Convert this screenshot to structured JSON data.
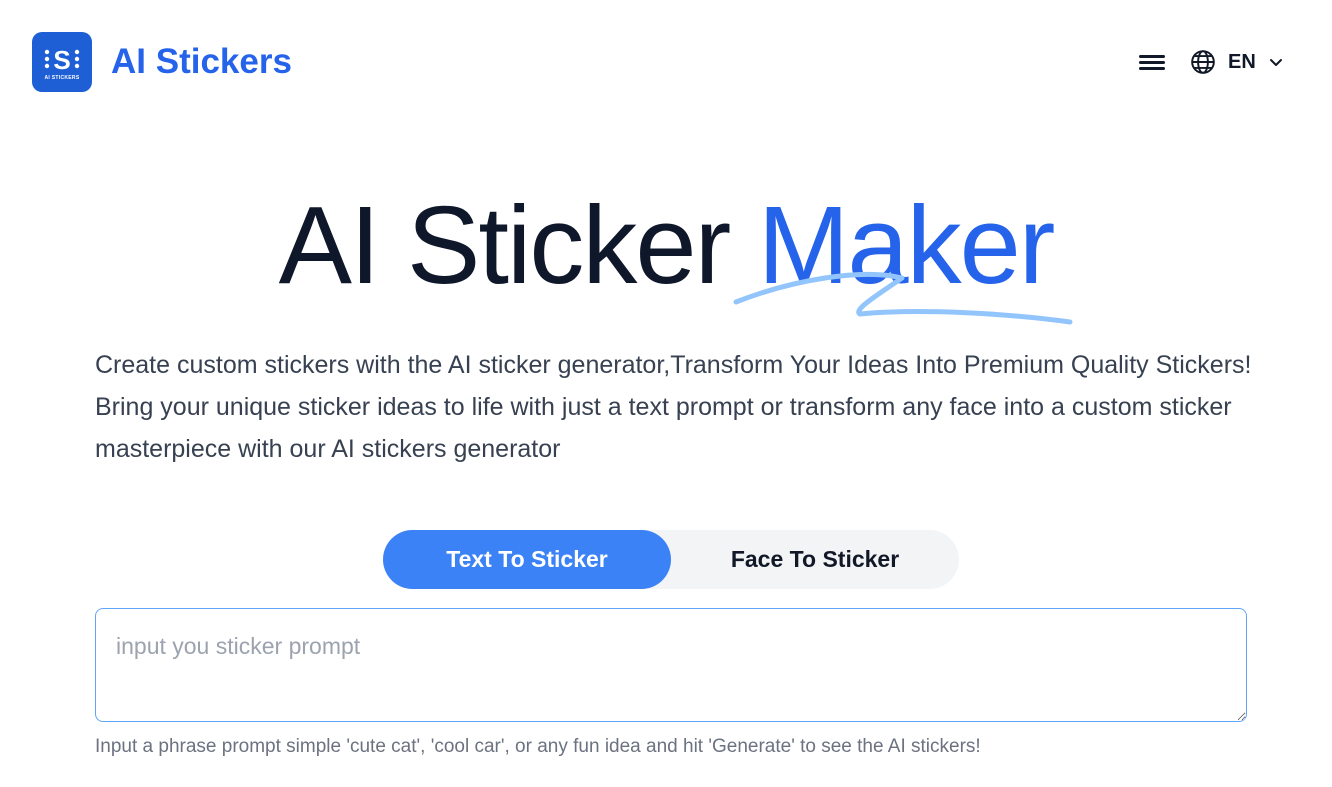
{
  "brand": {
    "name": "AI Stickers",
    "logo_caption": "AI STICKERS",
    "color": "#2563eb"
  },
  "header": {
    "menu_icon": "hamburger-icon",
    "language": {
      "icon": "globe-icon",
      "code": "EN",
      "chevron": "chevron-down-icon"
    }
  },
  "hero": {
    "title_main": "AI Sticker",
    "title_accent": "Maker",
    "accent_color": "#2563eb",
    "description": "Create custom stickers with the AI sticker generator,Transform Your Ideas Into Premium Quality Stickers! Bring your unique sticker ideas to life with just a text prompt or transform any face into a custom sticker masterpiece with our AI stickers generator"
  },
  "tabs": [
    {
      "label": "Text To Sticker",
      "active": true
    },
    {
      "label": "Face To Sticker",
      "active": false
    }
  ],
  "prompt": {
    "value": "",
    "placeholder": "input you sticker prompt",
    "hint": "Input a phrase prompt simple 'cute cat', 'cool car', or any fun idea and hit 'Generate' to see the AI stickers!"
  }
}
